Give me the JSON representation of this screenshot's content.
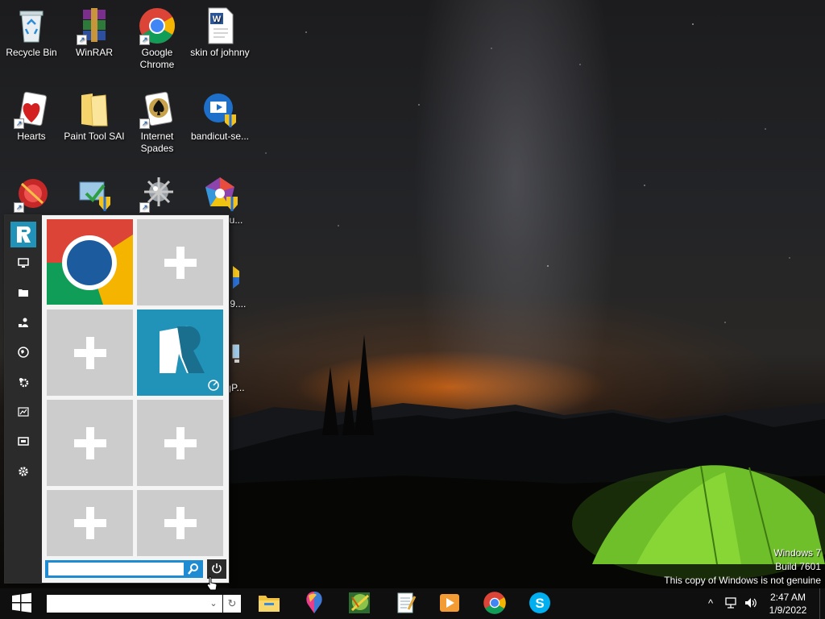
{
  "desktop": {
    "icons": [
      {
        "label": "Recycle Bin",
        "icon": "recycle-bin-icon"
      },
      {
        "label": "WinRAR",
        "icon": "winrar-icon"
      },
      {
        "label": "Google Chrome",
        "icon": "chrome-icon"
      },
      {
        "label": "skin of johnny",
        "icon": "word-document-icon"
      },
      {
        "label": "Hearts",
        "icon": "hearts-game-icon"
      },
      {
        "label": "Paint Tool SAI",
        "icon": "folder-icon"
      },
      {
        "label": "Internet Spades",
        "icon": "spades-game-icon"
      },
      {
        "label": "bandicut-se...",
        "icon": "bandicut-setup-icon"
      },
      {
        "label": "",
        "icon": "red-app-icon"
      },
      {
        "label": "",
        "icon": "installer-shield-icon"
      },
      {
        "label": "",
        "icon": "minesweeper-icon"
      },
      {
        "label": "...etu...",
        "icon": "colorful-setup-icon"
      },
      {
        "label": "...79....",
        "icon": "partial-icon"
      },
      {
        "label": "...gP...",
        "icon": "partial-computer-icon"
      }
    ]
  },
  "start_panel": {
    "sidebar": [
      {
        "name": "logo",
        "icon": "r-logo-icon"
      },
      {
        "name": "computer",
        "icon": "monitor-icon"
      },
      {
        "name": "folders",
        "icon": "folder-icon"
      },
      {
        "name": "users",
        "icon": "users-icon"
      },
      {
        "name": "network",
        "icon": "globe-icon"
      },
      {
        "name": "programs",
        "icon": "gears-icon"
      },
      {
        "name": "performance",
        "icon": "chart-icon"
      },
      {
        "name": "display",
        "icon": "display-icon"
      },
      {
        "name": "settings",
        "icon": "settings-gear-icon"
      }
    ],
    "tiles": [
      {
        "type": "app",
        "icon": "chrome-icon"
      },
      {
        "type": "add",
        "icon": "plus-icon"
      },
      {
        "type": "add",
        "icon": "plus-icon"
      },
      {
        "type": "app",
        "icon": "r-logo-icon"
      },
      {
        "type": "add",
        "icon": "plus-icon"
      },
      {
        "type": "add",
        "icon": "plus-icon"
      },
      {
        "type": "add",
        "icon": "plus-icon"
      },
      {
        "type": "add",
        "icon": "plus-icon"
      }
    ],
    "search": {
      "value": "",
      "placeholder": ""
    },
    "colors": {
      "accent": "#1e8bd2",
      "sidebar": "#2b2b2b",
      "tile": "#cccccc",
      "r_tile": "#2193b9"
    }
  },
  "watermark": {
    "line1": "Windows 7",
    "line2": "Build 7601",
    "line3": "This copy of Windows is not genuine"
  },
  "taskbar": {
    "address": {
      "value": "",
      "placeholder": ""
    },
    "apps": [
      {
        "name": "file-explorer",
        "icon": "folder-icon"
      },
      {
        "name": "paint-3d",
        "icon": "balloon-icon"
      },
      {
        "name": "game",
        "icon": "globe-game-icon"
      },
      {
        "name": "notepad",
        "icon": "notepad-icon"
      },
      {
        "name": "media-player",
        "icon": "play-icon"
      },
      {
        "name": "chrome",
        "icon": "chrome-icon"
      },
      {
        "name": "skype",
        "icon": "skype-icon"
      }
    ],
    "tray": {
      "icons": [
        "chevron-up-icon",
        "network-icon",
        "volume-icon"
      ]
    },
    "clock": {
      "time": "2:47 AM",
      "date": "1/9/2022"
    }
  }
}
